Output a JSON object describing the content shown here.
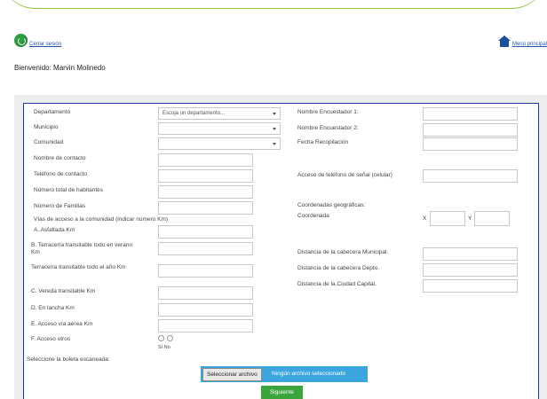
{
  "header": {
    "logout_label": "Cerrar sesión",
    "home_label": "Menú principal",
    "welcome": "Bienvenido: Marvin Molinedo"
  },
  "form": {
    "left": {
      "departamento_label": "Departamento",
      "departamento_value": "Escoja un departamento...",
      "municipio_label": "Municipio",
      "comunidad_label": "Comunidad",
      "nombre_contacto_label": "Nombre de contacto",
      "telefono_contacto_label": "Teléfono de contacto",
      "numero_habitantes_label": "Número total de habitantes",
      "numero_familias_label": "Número de Familias",
      "vias_acceso_label": "Vías de acceso a la comunidad (indicar número Km)",
      "via_a_label": "A. Asfaltada Km",
      "via_b_label": "B. Terracería transitable todo en verano Km",
      "via_c_label": "Terracería transitable todo el año Km",
      "via_d_label": "C. Vereda transitable Km",
      "via_e_label": "D. En lancha Km",
      "via_f_label": "E. Acceso vía aérea Km",
      "otros_label": "F. Acceso otros",
      "radio_options": "Sí   No",
      "file_prompt": "Seleccione la boleta escaneada:"
    },
    "right": {
      "encuestador1_label": "Nombre Encuestador 1:",
      "encuestador2_label": "Nombre Encuestador 2:",
      "fecha_label": "Fecha Recopilación",
      "acceso_celular_label": "Acceso de teléfono de señal (celular)",
      "coordenadas_label": "Coordenadas geográficas:",
      "coordenada_label": "Coordenada",
      "x_label": "X",
      "y_label": "Y",
      "dist_municipal_label": "Distancia de la cabecera Municipal.",
      "dist_departamental_label": "Distancia de la cabecera Depto.",
      "dist_capital_label": "Distancia de la Ciudad Capital."
    },
    "file_button_label": "Seleccionar archivo",
    "file_status": "Ningún archivo seleccionado",
    "next_button_label": "Siguiente"
  }
}
